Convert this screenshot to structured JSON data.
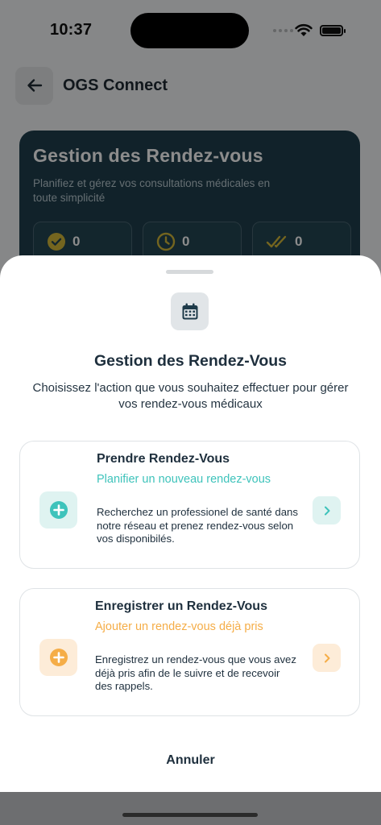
{
  "status_bar": {
    "time": "10:37"
  },
  "header": {
    "title": "OGS Connect"
  },
  "hero": {
    "title": "Gestion des Rendez-vous",
    "subtitle": "Planifiez et gérez vos consultations médicales en toute simplicité",
    "stats": [
      {
        "icon": "check-circle-icon",
        "value": "0",
        "color": "#d4b93a"
      },
      {
        "icon": "clock-icon",
        "value": "0",
        "color": "#d4b93a"
      },
      {
        "icon": "double-check-icon",
        "value": "0",
        "color": "#d4b93a"
      }
    ]
  },
  "sheet": {
    "icon": "calendar-icon",
    "title": "Gestion des Rendez-Vous",
    "description": "Choisissez l'action que vous souhaitez effectuer pour gérer vos rendez-vous médicaux",
    "options": [
      {
        "title": "Prendre Rendez-Vous",
        "subtitle": "Planifier un nouveau rendez-vous",
        "text": "Recherchez un professionel de santé dans notre réseau et prenez rendez-vous selon vos disponibilés.",
        "accent": "#3ec3bb",
        "icon": "plus-circle-icon"
      },
      {
        "title": "Enregistrer un Rendez-Vous",
        "subtitle": "Ajouter un rendez-vous déjà pris",
        "text": "Enregistrez un rendez-vous que vous avez déjà pris afin de le suivre et de recevoir des rappels.",
        "accent": "#f5ad47",
        "icon": "plus-circle-icon"
      }
    ],
    "cancel_label": "Annuler"
  }
}
